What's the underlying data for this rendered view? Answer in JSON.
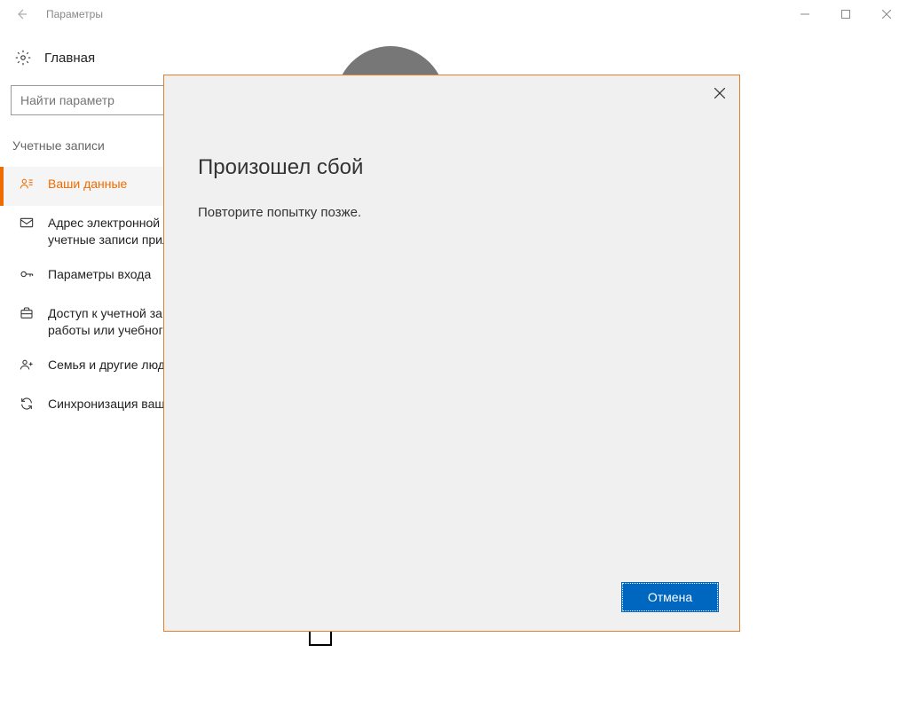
{
  "window": {
    "title": "Параметры"
  },
  "sidebar": {
    "home": "Главная",
    "search_placeholder": "Найти параметр",
    "category": "Учетные записи",
    "items": [
      {
        "label": "Ваши данные"
      },
      {
        "label": "Адрес электронной почты; учетные записи приложения"
      },
      {
        "label": "Параметры входа"
      },
      {
        "label": "Доступ к учетной записи места работы или учебного заведения"
      },
      {
        "label": "Семья и другие люди"
      },
      {
        "label": "Синхронизация ваших параметров"
      }
    ]
  },
  "dialog": {
    "title": "Произошел сбой",
    "message": "Повторите попытку позже.",
    "cancel": "Отмена"
  }
}
